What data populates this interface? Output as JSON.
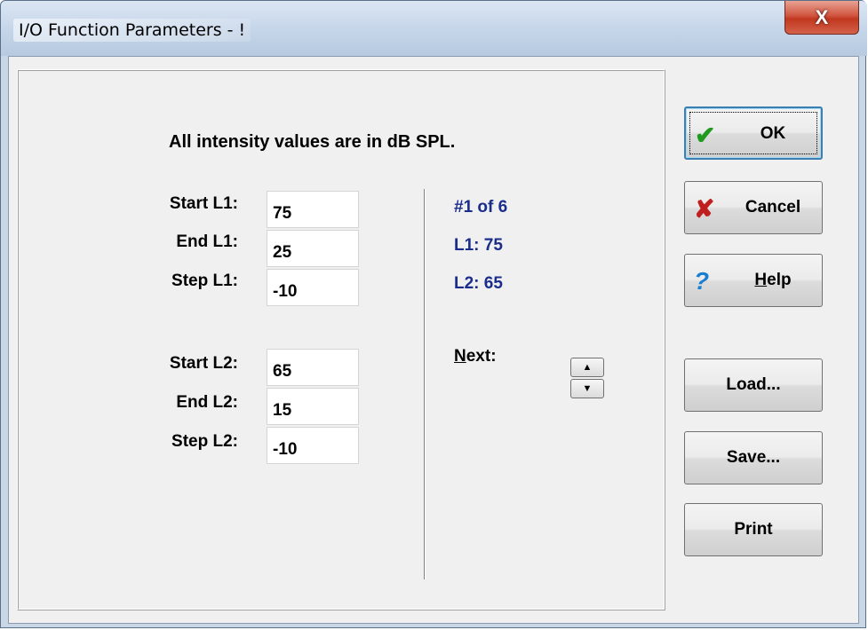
{
  "window": {
    "title": "I/O Function Parameters - !",
    "close_glyph": "X"
  },
  "note": "All intensity values are in dB SPL.",
  "l1": {
    "start_label": "Start L1:",
    "start_value": "75",
    "end_label": "End L1:",
    "end_value": "25",
    "step_label": "Step L1:",
    "step_value": "-10"
  },
  "l2": {
    "start_label": "Start L2:",
    "start_value": "65",
    "end_label": "End L2:",
    "end_value": "15",
    "step_label": "Step L2:",
    "step_value": "-10"
  },
  "status": {
    "counter": "#1 of 6",
    "l1": "L1:  75",
    "l2": "L2:  65"
  },
  "next": {
    "label": "Next:",
    "up_glyph": "▲",
    "down_glyph": "▼"
  },
  "buttons": {
    "ok": "OK",
    "cancel": "Cancel",
    "help": "Help",
    "load": "Load...",
    "save": "Save...",
    "print": "Print"
  },
  "icons": {
    "ok": "check-icon",
    "cancel": "x-icon",
    "help": "question-icon",
    "ok_color": "#1f9a1f",
    "cancel_color": "#c01f1f",
    "help_color": "#1a7fd0"
  },
  "colors": {
    "status_text": "#1a2d8a"
  }
}
